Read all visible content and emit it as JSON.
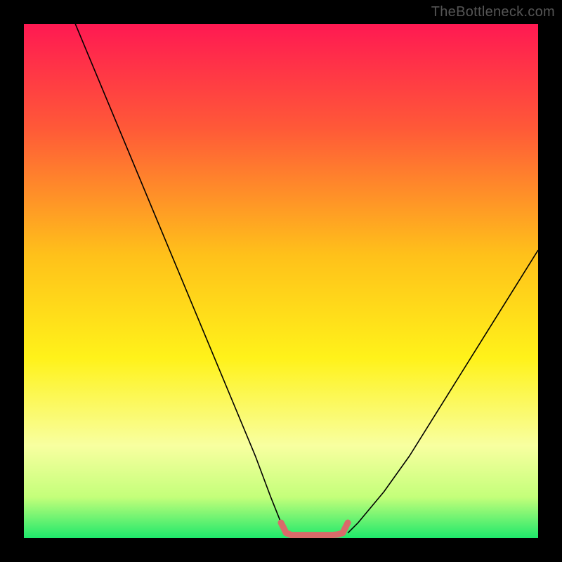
{
  "watermark": "TheBottleneck.com",
  "chart_data": {
    "type": "line",
    "title": "",
    "xlabel": "",
    "ylabel": "",
    "xlim": [
      0,
      100
    ],
    "ylim": [
      0,
      100
    ],
    "background_gradient": {
      "stops": [
        {
          "offset": 0.0,
          "color": "#ff1952"
        },
        {
          "offset": 0.2,
          "color": "#ff5838"
        },
        {
          "offset": 0.45,
          "color": "#ffc11a"
        },
        {
          "offset": 0.65,
          "color": "#fff21a"
        },
        {
          "offset": 0.82,
          "color": "#f8ffa0"
        },
        {
          "offset": 0.92,
          "color": "#c4ff7a"
        },
        {
          "offset": 1.0,
          "color": "#1ee86b"
        }
      ]
    },
    "series": [
      {
        "name": "curve-left",
        "stroke": "#000000",
        "x": [
          10,
          15,
          20,
          25,
          30,
          35,
          40,
          45,
          48,
          50,
          51
        ],
        "y": [
          100,
          88,
          76,
          64,
          52,
          40,
          28,
          16,
          8,
          3,
          1
        ]
      },
      {
        "name": "curve-right",
        "stroke": "#000000",
        "x": [
          63,
          65,
          70,
          75,
          80,
          85,
          90,
          95,
          100
        ],
        "y": [
          1,
          3,
          9,
          16,
          24,
          32,
          40,
          48,
          56
        ]
      },
      {
        "name": "trough",
        "stroke": "#d96a6a",
        "x": [
          50,
          51,
          52,
          53,
          54,
          55,
          56,
          57,
          58,
          59,
          60,
          61,
          62,
          63
        ],
        "y": [
          3,
          1,
          0.6,
          0.6,
          0.6,
          0.6,
          0.6,
          0.6,
          0.6,
          0.6,
          0.6,
          0.7,
          1,
          3
        ]
      }
    ]
  }
}
